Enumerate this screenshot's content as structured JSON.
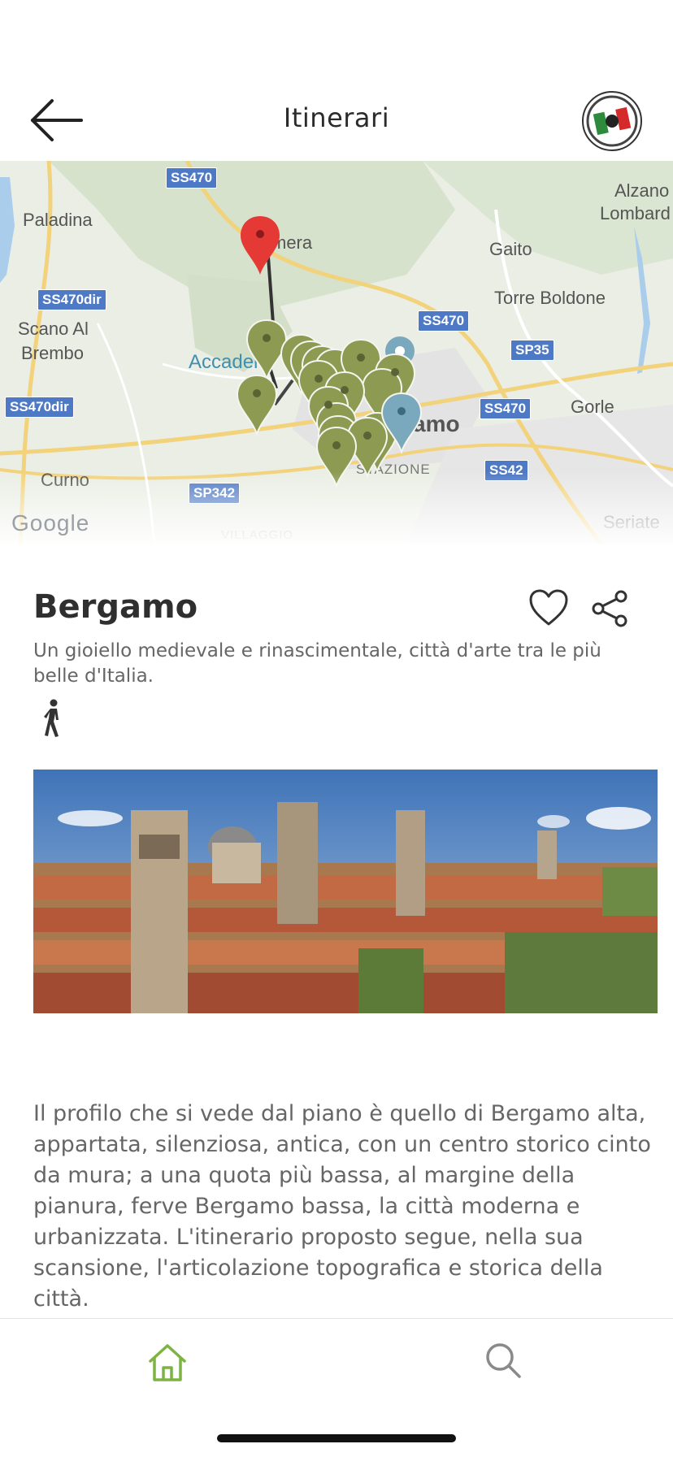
{
  "header": {
    "title": "Itinerari",
    "back_icon": "arrow-left-icon",
    "logo_icon": "tci-logo-icon"
  },
  "map": {
    "places": {
      "paladina": "Paladina",
      "scano": "Scano Al",
      "brembo": "Brembo",
      "curno": "Curno",
      "gaito": "Gaito",
      "torre_boldone": "Torre Boldone",
      "gorle": "Gorle",
      "alzano": "Alzano",
      "lombardo": "Lombard",
      "seriate": "Seriate",
      "mera": "mera",
      "accademia": "Accadem",
      "amo": "amo",
      "stazione": "STAZIONE",
      "villaggio": "VILLAGGIO"
    },
    "roads": {
      "ss470_top": "SS470",
      "ss470dir_a": "SS470dir",
      "ss470dir_b": "SS470dir",
      "ss470_mid": "SS470",
      "sp35": "SP35",
      "ss470_right": "SS470",
      "ss42": "SS42",
      "sp342": "SP342"
    },
    "google": "Google",
    "marker_colors": {
      "start": "#e53935",
      "stop": "#8c9a52",
      "info": "#7aa9bd"
    }
  },
  "itinerary": {
    "title": "Bergamo",
    "subtitle": "Un gioiello medievale e rinascimentale, città d'arte tra le più belle d'Italia.",
    "mode_icon": "walking-person-icon",
    "favorite_icon": "heart-icon",
    "share_icon": "share-icon",
    "description": "Il profilo che si vede dal piano è quello di Bergamo alta, appartata, silenziosa, antica, con un centro storico cinto da mura; a una quota più bassa, al margine della pianura, ferve Bergamo bassa, la città moderna e urbanizzata. L'itinerario proposto segue, nella sua scansione, l'articolazione topografica e storica della città."
  },
  "tabbar": {
    "home_icon": "home-icon",
    "search_icon": "search-icon",
    "active_color": "#7cb342"
  }
}
